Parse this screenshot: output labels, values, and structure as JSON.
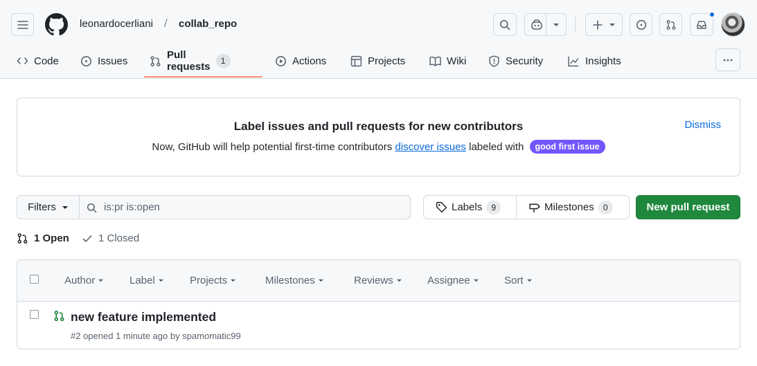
{
  "header": {
    "owner": "leonardocerliani",
    "separator": "/",
    "repo": "collab_repo"
  },
  "tabs": [
    {
      "label": "Code",
      "icon": "code-icon"
    },
    {
      "label": "Issues",
      "icon": "issue-opened-icon"
    },
    {
      "label": "Pull requests",
      "icon": "git-pull-request-icon",
      "count": "1",
      "active": true
    },
    {
      "label": "Actions",
      "icon": "play-icon"
    },
    {
      "label": "Projects",
      "icon": "table-icon"
    },
    {
      "label": "Wiki",
      "icon": "book-icon"
    },
    {
      "label": "Security",
      "icon": "shield-icon"
    },
    {
      "label": "Insights",
      "icon": "graph-icon"
    }
  ],
  "banner": {
    "title": "Label issues and pull requests for new contributors",
    "text_before": "Now, GitHub will help potential first-time contributors",
    "link": "discover issues",
    "text_after": "labeled with",
    "label_badge": "good first issue",
    "dismiss": "Dismiss"
  },
  "filters": {
    "button": "Filters",
    "search_value": "is:pr is:open"
  },
  "labels": {
    "label": "Labels",
    "count": "9"
  },
  "milestones": {
    "label": "Milestones",
    "count": "0"
  },
  "new_pr_button": "New pull request",
  "states": {
    "open": "1 Open",
    "closed": "1 Closed"
  },
  "list_filters": [
    "Author",
    "Label",
    "Projects",
    "Milestones",
    "Reviews",
    "Assignee",
    "Sort"
  ],
  "pull_requests": [
    {
      "title": "new feature implemented",
      "meta": "#2 opened 1 minute ago by spamomatic99"
    }
  ],
  "colors": {
    "accent": "#0969da",
    "primary_button": "#1f883d",
    "label_badge": "#7057ff",
    "tab_underline": "#fd8c73",
    "open_state": "#1a7f37"
  }
}
